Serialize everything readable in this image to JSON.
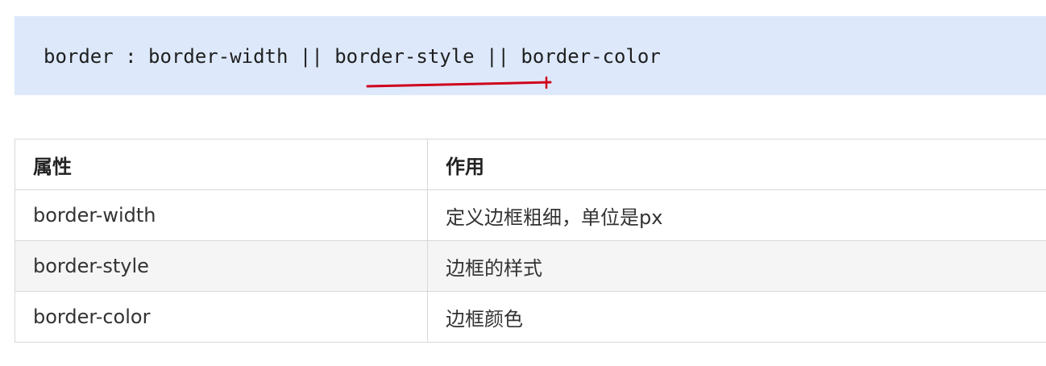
{
  "code": {
    "text": "border : border-width || border-style || border-color"
  },
  "table": {
    "headers": [
      "属性",
      "作用"
    ],
    "rows": [
      [
        "border-width",
        "定义边框粗细，单位是px"
      ],
      [
        "border-style",
        "边框的样式"
      ],
      [
        "border-color",
        "边框颜色"
      ]
    ]
  },
  "colors": {
    "code_background": "#dde9fb",
    "annotation": "#d0021b",
    "table_border": "#d8d8d8",
    "row_alt": "#f5f5f5"
  }
}
